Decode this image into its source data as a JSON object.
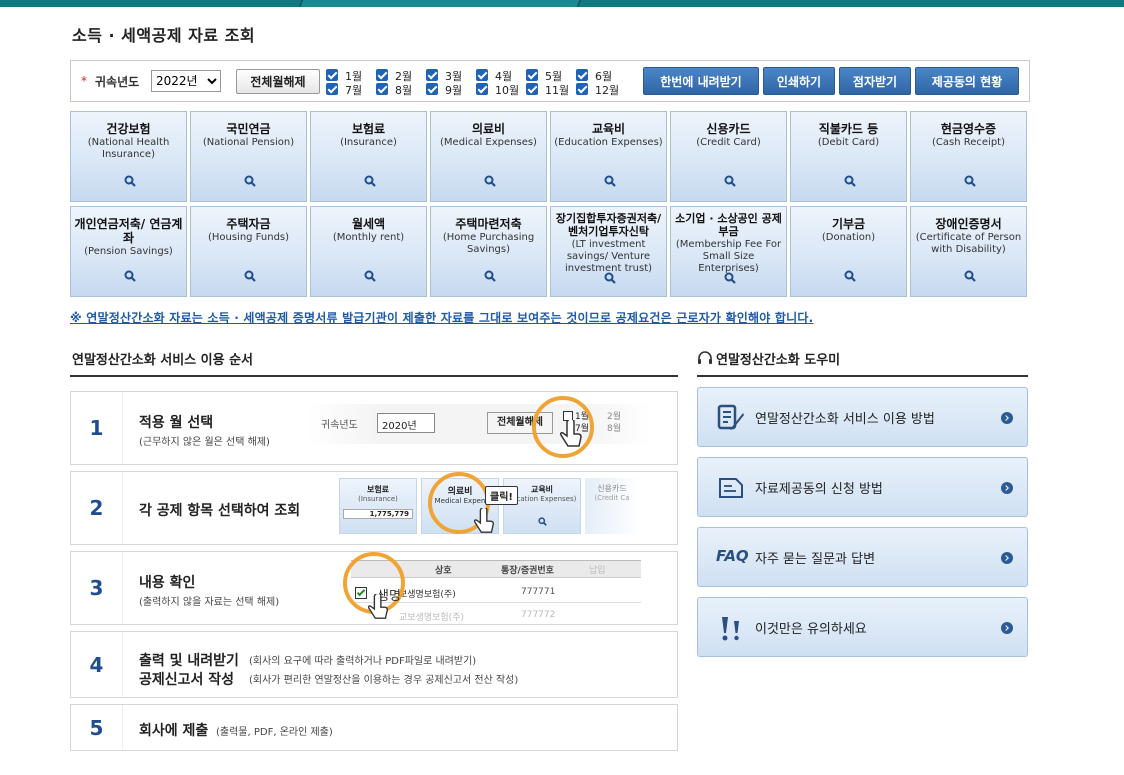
{
  "page_title": "소득 · 세액공제 자료 조회",
  "filter": {
    "required_mark": "*",
    "year_label": "귀속년도",
    "year_value": "2022년",
    "deselect_all_label": "전체월해제",
    "months": [
      "1월",
      "2월",
      "3월",
      "4월",
      "5월",
      "6월",
      "7월",
      "8월",
      "9월",
      "10월",
      "11월",
      "12월"
    ],
    "buttons": {
      "download_all": "한번에 내려받기",
      "print": "인쇄하기",
      "braille": "점자받기",
      "provider_status": "제공동의 현황"
    }
  },
  "categories": [
    {
      "ko": "건강보험",
      "en": "(National Health Insurance)"
    },
    {
      "ko": "국민연금",
      "en": "(National Pension)"
    },
    {
      "ko": "보험료",
      "en": "(Insurance)"
    },
    {
      "ko": "의료비",
      "en": "(Medical Expenses)"
    },
    {
      "ko": "교육비",
      "en": "(Education Expenses)"
    },
    {
      "ko": "신용카드",
      "en": "(Credit Card)"
    },
    {
      "ko": "직불카드 등",
      "en": "(Debit Card)"
    },
    {
      "ko": "현금영수증",
      "en": "(Cash Receipt)"
    },
    {
      "ko": "개인연금저축/ 연금계좌",
      "en": "(Pension Savings)"
    },
    {
      "ko": "주택자금",
      "en": "(Housing Funds)"
    },
    {
      "ko": "월세액",
      "en": "(Monthly rent)"
    },
    {
      "ko": "주택마련저축",
      "en": "(Home Purchasing Savings)"
    },
    {
      "ko": "장기집합투자증권저축/ 벤처기업투자신탁",
      "en": "(LT investment savings/ Venture investment trust)"
    },
    {
      "ko": "소기업 · 소상공인 공제부금",
      "en": "(Membership Fee For Small Size Enterprises)"
    },
    {
      "ko": "기부금",
      "en": "(Donation)"
    },
    {
      "ko": "장애인증명서",
      "en": "(Certificate of Person with Disability)"
    }
  ],
  "notice": "※ 연말정산간소화 자료는 소득 · 세액공제 증명서류 발급기관이 제출한 자료를 그대로 보여주는 것이므로 공제요건은 근로자가 확인해야 합니다.",
  "process": {
    "title": "연말정산간소화 서비스 이용 순서",
    "steps": [
      {
        "num": "1",
        "title": "적용 월 선택",
        "sub": "(근무하지 않은 월은 선택 해제)"
      },
      {
        "num": "2",
        "title": "각 공제 항목 선택하여 조회",
        "sub": ""
      },
      {
        "num": "3",
        "title": "내용 확인",
        "sub": "(출력하지 않을 자료는 선택 해제)"
      },
      {
        "num": "4",
        "title": "출력 및 내려받기",
        "title2": "공제신고서 작성",
        "sub": "(회사의 요구에 따라 출력하거나 PDF파일로 내려받기)",
        "sub2": "(회사가 편리한 연말정산을 이용하는 경우 공제신고서 전산 작성)"
      },
      {
        "num": "5",
        "title": "회사에 제출",
        "sub": "(출력물, PDF, 온라인 제출)"
      }
    ],
    "illus1": {
      "label": "귀속년도",
      "year": "2020년",
      "btn": "전체월해제",
      "m1": "1월",
      "m2": "2월",
      "m7": "7월",
      "m8": "8월"
    },
    "illus2": {
      "t1": "보험료",
      "e1": "(Insurance)",
      "v1": "1,775,779",
      "t2": "의료비",
      "e2": "Medical Expen",
      "t3": "교육비",
      "e3": "ducation Expenses)",
      "t4": "신용카드",
      "e4": "(Credit Ca",
      "click": "클릭!"
    },
    "illus3": {
      "h1": "상호",
      "h2": "통장/증권번호",
      "h3": "납입",
      "r1": "생명",
      "r1b": "보생명보험(주)",
      "v1": "777771",
      "v2": "777772",
      "r2": "교보생명보험(주)"
    }
  },
  "helper": {
    "title": "연말정산간소화 도우미",
    "items": [
      {
        "label": "연말정산간소화 서비스 이용 방법",
        "icon": "document-pen-icon"
      },
      {
        "label": "자료제공동의 신청 방법",
        "icon": "document-icon"
      },
      {
        "label": "자주 묻는 질문과 답변",
        "icon": "faq-icon",
        "prefix": "FAQ"
      },
      {
        "label": "이것만은 유의하세요",
        "icon": "caution-icon"
      }
    ]
  }
}
